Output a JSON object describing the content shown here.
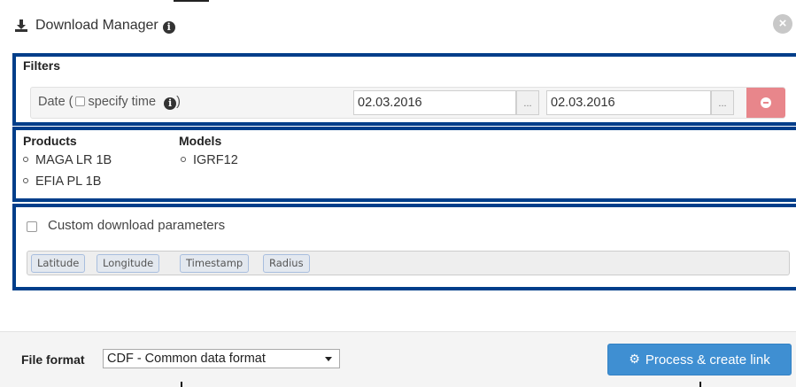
{
  "header": {
    "title": "Download Manager",
    "download_icon": "download-icon",
    "info_icon": "info-icon",
    "info_symbol": "i",
    "close_icon": "close-icon",
    "close_symbol": "×"
  },
  "filters": {
    "title": "Filters",
    "date_label_prefix": "Date (",
    "specify_time_label": "specify time",
    "date_label_suffix": ")",
    "start_date": "02.03.2016",
    "end_date": "02.03.2016",
    "ellipsis_label": "...",
    "remove_icon": "minus-circle-icon"
  },
  "selection": {
    "products_title": "Products",
    "products": [
      "MAGA LR 1B",
      "EFIA PL 1B"
    ],
    "models_title": "Models",
    "models": [
      "IGRF12"
    ]
  },
  "custom": {
    "label": "Custom download parameters",
    "checked": false,
    "tags": [
      "Latitude",
      "Longitude",
      "Timestamp",
      "Radius"
    ]
  },
  "footer": {
    "file_format_label": "File format",
    "file_format_value": "CDF - Common data format",
    "process_label": "Process & create link",
    "process_icon": "cogs-icon"
  },
  "colors": {
    "highlight": "#003e8a",
    "primary_button": "#3f8fd2",
    "danger_button": "#e8868b"
  }
}
